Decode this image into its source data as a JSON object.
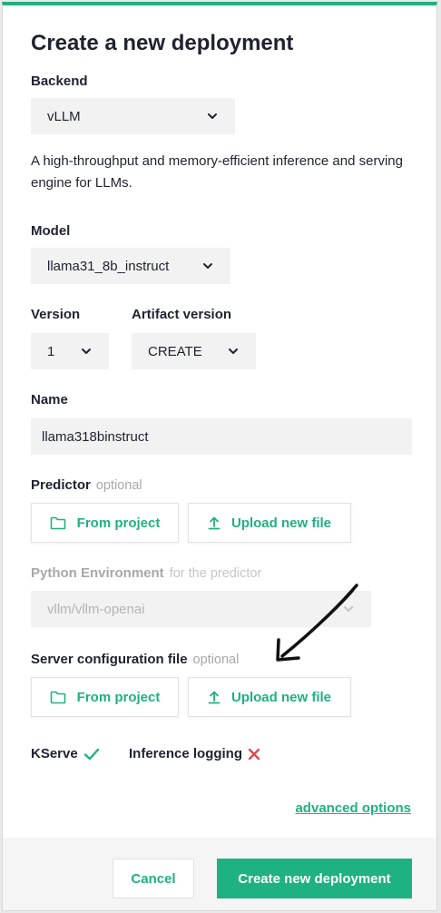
{
  "dialog": {
    "title": "Create a new deployment"
  },
  "backend": {
    "label": "Backend",
    "value": "vLLM",
    "description": "A high-throughput and memory-efficient inference and serving engine for LLMs."
  },
  "model": {
    "label": "Model",
    "value": "llama31_8b_instruct"
  },
  "version": {
    "label": "Version",
    "value": "1"
  },
  "artifact_version": {
    "label": "Artifact version",
    "value": "CREATE"
  },
  "name": {
    "label": "Name",
    "value": "llama318binstruct"
  },
  "predictor": {
    "label": "Predictor",
    "optional": "optional",
    "from_project": "From project",
    "upload": "Upload new file"
  },
  "python_env": {
    "label": "Python Environment",
    "hint": "for the predictor",
    "value": "vllm/vllm-openai"
  },
  "server_config": {
    "label": "Server configuration file",
    "optional": "optional",
    "from_project": "From project",
    "upload": "Upload new file"
  },
  "kserve": {
    "label": "KServe",
    "status": "enabled"
  },
  "inference_logging": {
    "label": "Inference logging",
    "status": "disabled"
  },
  "advanced_options": "advanced options",
  "footer": {
    "cancel": "Cancel",
    "create": "Create new deployment"
  },
  "colors": {
    "accent": "#1eb182",
    "error": "#e0474c",
    "text": "#1f2230",
    "muted": "#a8a8a8"
  },
  "icons": [
    "chevron-down-icon",
    "folder-icon",
    "upload-icon",
    "check-icon",
    "x-icon",
    "arrow-annotation"
  ]
}
